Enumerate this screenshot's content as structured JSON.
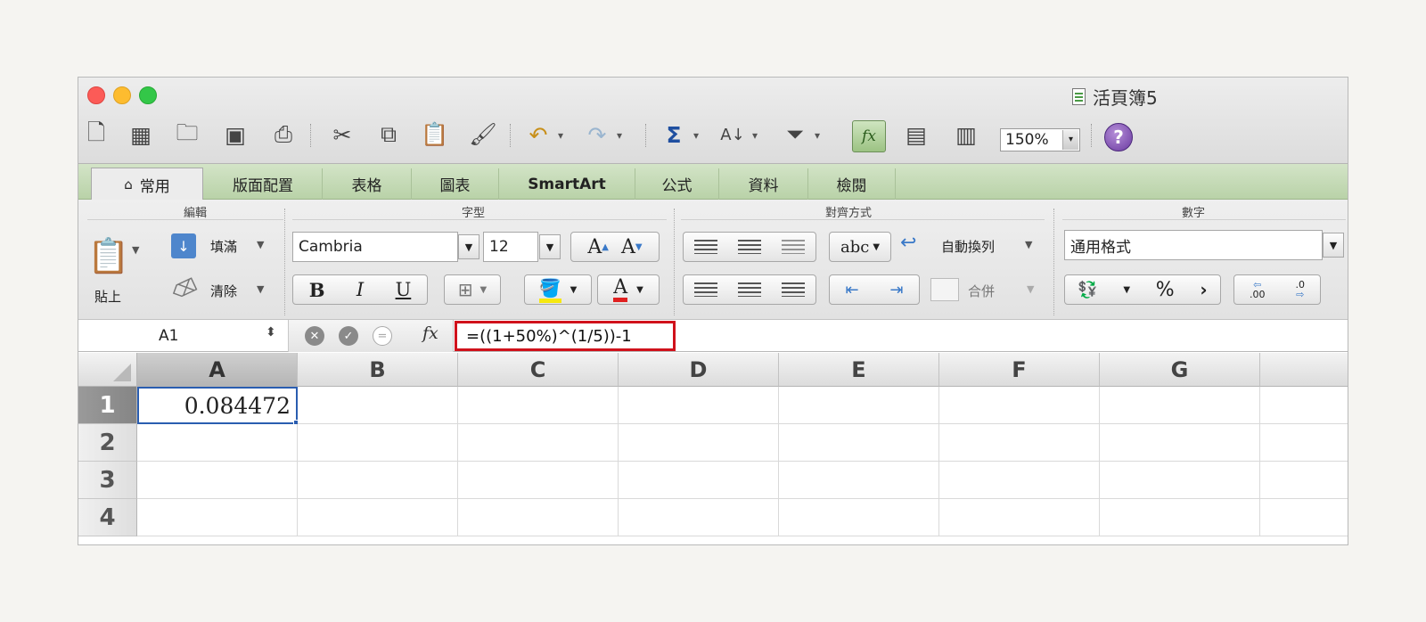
{
  "window": {
    "title": "活頁簿5"
  },
  "toolbar": {
    "zoom": "150%",
    "help": "?"
  },
  "tabs": [
    "常用",
    "版面配置",
    "表格",
    "圖表",
    "SmartArt",
    "公式",
    "資料",
    "檢閱"
  ],
  "ribbon": {
    "groups": {
      "edit": "編輯",
      "font": "字型",
      "align": "對齊方式",
      "number": "數字"
    },
    "paste": "貼上",
    "fill": "填滿",
    "clear": "清除",
    "font_name": "Cambria",
    "font_size": "12",
    "bold": "B",
    "italic": "I",
    "underline": "U",
    "grow_font": "A",
    "shrink_font": "A",
    "font_color": "A",
    "orientation": "abc",
    "wrap_text": "自動換列",
    "merge": "合併",
    "number_format": "通用格式",
    "percent": "%",
    "comma": "›",
    "inc_decimal": ".00",
    "dec_decimal": ".0"
  },
  "formula_bar": {
    "name_box": "A1",
    "fx": "fx",
    "formula": "=((1+50%)^(1/5))-1"
  },
  "sheet": {
    "columns": [
      "A",
      "B",
      "C",
      "D",
      "E",
      "F",
      "G"
    ],
    "rows": [
      "1",
      "2",
      "3",
      "4"
    ],
    "cells": {
      "A1": "0.084472"
    }
  },
  "colors": {
    "highlight_box": "#d0111b",
    "selection": "#2a5db0",
    "ribbon_tabs": "#c7dbb8"
  }
}
